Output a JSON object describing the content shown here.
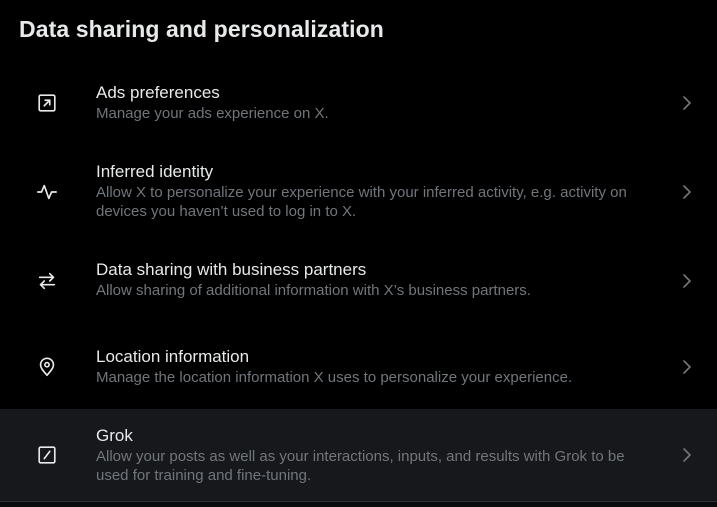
{
  "page": {
    "title": "Data sharing and personalization"
  },
  "items": [
    {
      "label": "Ads preferences",
      "description": "Manage your ads experience on X.",
      "icon": "external-arrow-icon"
    },
    {
      "label": "Inferred identity",
      "description": "Allow X to personalize your experience with your inferred activity, e.g. activity on devices you haven’t used to log in to X.",
      "icon": "activity-pulse-icon"
    },
    {
      "label": "Data sharing with business partners",
      "description": "Allow sharing of additional information with X’s business partners.",
      "icon": "swap-arrows-icon"
    },
    {
      "label": "Location information",
      "description": "Manage the location information X uses to personalize your experience.",
      "icon": "location-pin-icon"
    },
    {
      "label": "Grok",
      "description": "Allow your posts as well as your interactions, inputs, and results with Grok to be used for training and fine-tuning.",
      "icon": "grok-slash-icon",
      "highlighted": true
    }
  ],
  "colors": {
    "background": "#000000",
    "text_primary": "#e7e9ea",
    "text_secondary": "#71767b",
    "hover_row": "#16181c"
  }
}
